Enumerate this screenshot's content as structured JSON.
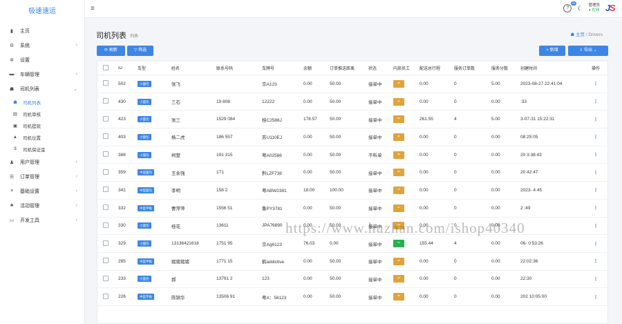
{
  "app": {
    "brand": "极速速运"
  },
  "sidebar": {
    "items": [
      {
        "icon": "bar-chart-icon",
        "glyph": "▮",
        "label": "主页",
        "arrow": ""
      },
      {
        "icon": "gear-icon",
        "glyph": "⚙",
        "label": "系统",
        "arrow": "‹"
      },
      {
        "icon": "gear-small-icon",
        "glyph": "✲",
        "label": "设置",
        "arrow": ""
      },
      {
        "icon": "car-icon",
        "glyph": "▬",
        "label": "车辆管理",
        "arrow": "‹"
      },
      {
        "icon": "users-icon",
        "glyph": "☗",
        "label": "司机列表",
        "arrow": "⌄"
      }
    ],
    "sub_items": [
      {
        "icon": "user-list-icon",
        "glyph": "☗",
        "label": "司机列表",
        "active": true
      },
      {
        "icon": "audit-icon",
        "glyph": "▤",
        "label": "司机审核",
        "active": false
      },
      {
        "icon": "withdraw-icon",
        "glyph": "▣",
        "label": "司机提现",
        "active": false
      },
      {
        "icon": "location-icon",
        "glyph": "▲",
        "label": "司机位置",
        "active": false
      },
      {
        "icon": "deposit-icon",
        "glyph": "$",
        "label": "司机保证金",
        "active": false
      }
    ],
    "items2": [
      {
        "icon": "user-icon",
        "glyph": "♟",
        "label": "用户管理",
        "arrow": "‹"
      },
      {
        "icon": "order-icon",
        "glyph": "☰",
        "label": "订单管理",
        "arrow": "‹"
      },
      {
        "icon": "list-icon",
        "glyph": "≡",
        "label": "基础设置",
        "arrow": "‹"
      },
      {
        "icon": "activity-icon",
        "glyph": "♣",
        "label": "活动管理",
        "arrow": "‹"
      },
      {
        "icon": "dev-tools-icon",
        "glyph": "▭",
        "label": "开发工具",
        "arrow": "‹"
      }
    ]
  },
  "topbar": {
    "help_badge": "99",
    "user_name": "管理员",
    "user_status": "● 在线"
  },
  "page": {
    "title": "司机列表",
    "subtitle": "列表",
    "breadcrumb_home": "主页",
    "breadcrumb_sep": "/",
    "breadcrumb_current": "Drivers"
  },
  "toolbar": {
    "refresh": "⟳ 刷新",
    "filter": "▽ 筛选",
    "add": "+ 新增",
    "export": "⇩ 导出 ⌄"
  },
  "table": {
    "headers": {
      "id": "ID",
      "type": "车型",
      "name": "姓名",
      "phone": "联系号码",
      "plate": "车牌号",
      "balance": "余额",
      "distance": "订单推送距离",
      "status": "状态",
      "employee": "内部员工",
      "total": "配送总行程",
      "orders": "服务订单数",
      "score": "服务分数",
      "created": "创建时间",
      "op": "操作"
    },
    "rows": [
      {
        "id": "502",
        "type": "小面包",
        "name": "张飞",
        "phone": "",
        "plate": "京A123",
        "balance": "0.00",
        "distance": "50.00",
        "status": "接单中",
        "emp": "=",
        "emp_green": false,
        "total": "0.00",
        "orders": "0",
        "score": "5.00",
        "created": "2023-08-27 22:41:04"
      },
      {
        "id": "430",
        "type": "小面包",
        "name": "三石",
        "phone": "19 808",
        "plate": "12222",
        "balance": "0.00",
        "distance": "50.00",
        "status": "接单中",
        "emp": "=",
        "emp_green": false,
        "total": "0.00",
        "orders": "0",
        "score": "0.00",
        "created": ":33"
      },
      {
        "id": "423",
        "type": "小面包",
        "name": "张三",
        "phone": "1529 084",
        "plate": "桂C2586J",
        "balance": "178.57",
        "distance": "50.00",
        "status": "接单中",
        "emp": "=",
        "emp_green": false,
        "total": "261.55",
        "orders": "4",
        "score": "5.00",
        "created": "3-07-31 15:22:31"
      },
      {
        "id": "403",
        "type": "小面包",
        "name": "杨二虎",
        "phone": "186 557",
        "plate": "苏U110EJ",
        "balance": "0.00",
        "distance": "50.00",
        "status": "接单中",
        "emp": "=",
        "emp_green": false,
        "total": "0.00",
        "orders": "0",
        "score": "0.00",
        "created": "08:25:05"
      },
      {
        "id": "366",
        "type": "小面包",
        "name": "柯楚",
        "phone": "191 315",
        "plate": "粤A02586",
        "balance": "0.00",
        "distance": "50.00",
        "status": "不听单",
        "emp": "=",
        "emp_green": false,
        "total": "0.00",
        "orders": "0",
        "score": "0.00",
        "created": "20 3:38:43"
      },
      {
        "id": "359",
        "type": "中型面包",
        "name": "王永强",
        "phone": "171",
        "plate": "黔LZF738",
        "balance": "0.00",
        "distance": "50.00",
        "status": "接单中",
        "emp": "=",
        "emp_green": false,
        "total": "0.00",
        "orders": "0",
        "score": "0.00",
        "created": "20 42:47"
      },
      {
        "id": "341",
        "type": "中型面包",
        "name": "李明",
        "phone": "158 2",
        "plate": "粤ABW2381",
        "balance": "18.00",
        "distance": "100.00",
        "status": "接单中",
        "emp": "=",
        "emp_green": false,
        "total": "0.00",
        "orders": "0",
        "score": "0.00",
        "created": "2023- 4:45"
      },
      {
        "id": "332",
        "type": "中型平板",
        "name": "曹萍萍",
        "phone": "1556 51",
        "plate": "鲁PY3781",
        "balance": "0.00",
        "distance": "50.00",
        "status": "接单中",
        "emp": "=",
        "emp_green": false,
        "total": "0.00",
        "orders": "0",
        "score": "0.00",
        "created": "2 :49"
      },
      {
        "id": "330",
        "type": "小面包",
        "name": "桂花",
        "phone": "13611",
        "plate": "JPA76890",
        "balance": "0.00",
        "distance": "50.00",
        "status": "接单中",
        "emp": "=",
        "emp_green": false,
        "total": "0.00",
        "orders": "0",
        "score": "0.00",
        "created": ""
      },
      {
        "id": "329",
        "type": "小面包",
        "name": "13136421618",
        "phone": "1751 95",
        "plate": "京Ag6123",
        "balance": "76.03",
        "distance": "0.00",
        "status": "接单中",
        "emp": "=",
        "emp_green": true,
        "total": "155.44",
        "orders": "4",
        "score": "0.00",
        "created": "06- 0:53:26"
      },
      {
        "id": "285",
        "type": "中型平板",
        "name": "猪猪猪猪",
        "phone": "1771 15",
        "plate": "鹤addictive",
        "balance": "0.00",
        "distance": "50.00",
        "status": "接单中",
        "emp": "=",
        "emp_green": false,
        "total": "0.00",
        "orders": "0",
        "score": "0.00",
        "created": "22:02:36"
      },
      {
        "id": "233",
        "type": "小面包",
        "name": "郝",
        "phone": "13791 2",
        "plate": "123",
        "balance": "0.00",
        "distance": "50.00",
        "status": "接单中",
        "emp": "=",
        "emp_green": false,
        "total": "0.00",
        "orders": "0",
        "score": "0.00",
        "created": "22:30"
      },
      {
        "id": "226",
        "type": "中型平板",
        "name": "陈锦华",
        "phone": "13506 91",
        "plate": "粤A：56123",
        "balance": "0.00",
        "distance": "50.00",
        "status": "接单中",
        "emp": "=",
        "emp_green": false,
        "total": "0.00",
        "orders": "0",
        "score": "0.00",
        "created": "202 10:05:00"
      }
    ]
  },
  "watermark": "https://www.huzhan.com/ishop40340"
}
